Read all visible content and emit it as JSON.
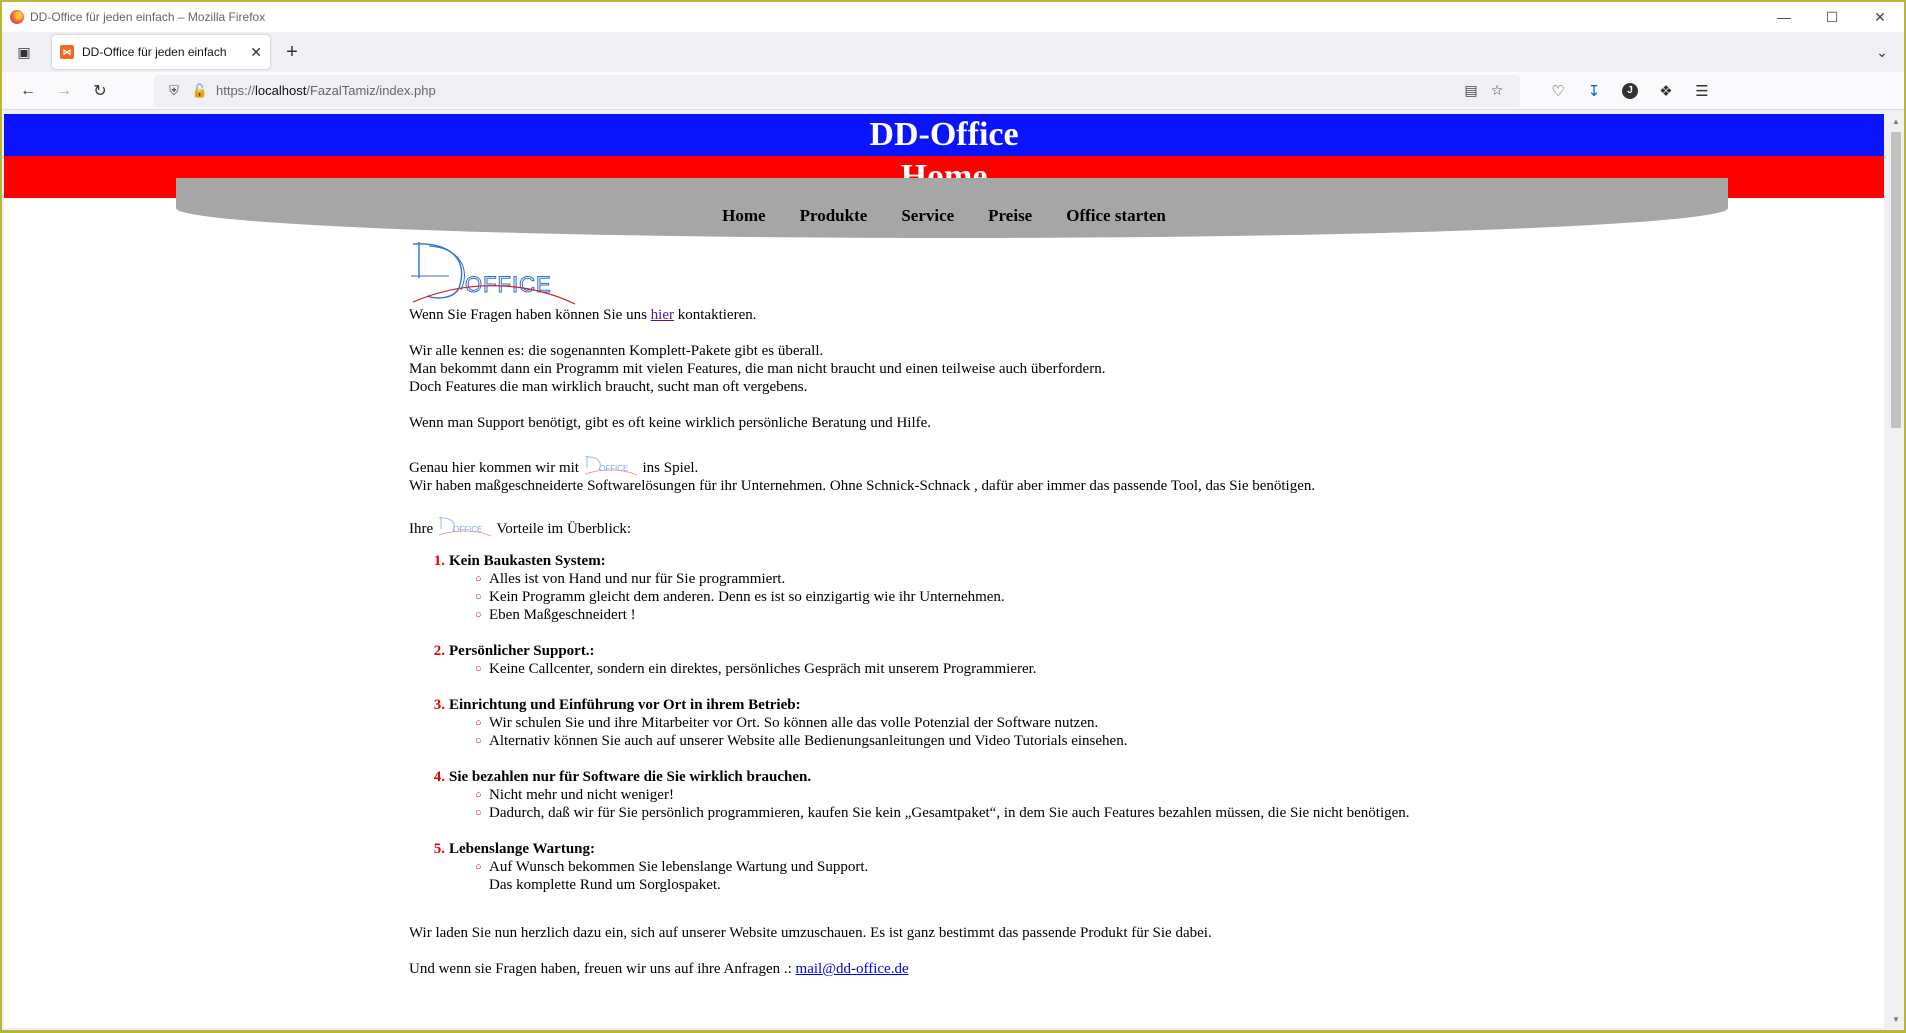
{
  "window": {
    "title": "DD-Office für jeden einfach – Mozilla Firefox"
  },
  "tab": {
    "title": "DD-Office für jeden einfach",
    "favicon": "xampp-icon"
  },
  "urlbar": {
    "prefix": "https://",
    "host": "localhost",
    "path": "/FazalTamiz/index.php"
  },
  "site": {
    "brand": "DD-Office",
    "page_title": "Home",
    "colors": {
      "header": "#0a14ff",
      "subheader": "#ff0000",
      "menu_bg": "#a6a6a6",
      "accent": "#e00000"
    },
    "menu": [
      "Home",
      "Produkte",
      "Service",
      "Preise",
      "Office starten"
    ],
    "logo_text": "OFFICE",
    "contact": {
      "before": "Wenn Sie Fragen haben können Sie uns ",
      "link": "hier",
      "after": " kontaktieren."
    },
    "intro": [
      "Wir alle kennen es: die sogenannten Komplett-Pakete gibt es überall.",
      "Man bekommt dann ein Programm mit vielen Features, die man nicht braucht und einen teilweise auch überfordern.",
      "Doch Features die man wirklich braucht, sucht man oft vergebens."
    ],
    "support": "Wenn man Support benötigt, gibt es oft keine wirklich persönliche Beratung und Hilfe.",
    "genau_before": "Genau hier kommen wir mit",
    "genau_after": "ins Spiel.",
    "tailored": "Wir haben maßgeschneiderte Softwarelösungen für ihr Unternehmen. Ohne Schnick-Schnack , dafür aber immer das passende Tool, das Sie benötigen.",
    "ihre_before": "Ihre",
    "ihre_after": "Vorteile im Überblick:",
    "advantages": [
      {
        "num": "1.",
        "title": "Kein Baukasten System:",
        "items": [
          "Alles ist von Hand und nur für Sie programmiert.",
          "Kein Programm gleicht dem anderen. Denn es ist so einzigartig wie ihr Unternehmen.",
          "Eben Maßgeschneidert !"
        ]
      },
      {
        "num": "2.",
        "title": "Persönlicher Support.:",
        "items": [
          "Keine Callcenter, sondern ein direktes, persönliches Gespräch mit unserem Programmierer."
        ]
      },
      {
        "num": "3.",
        "title": "Einrichtung und Einführung vor Ort in ihrem Betrieb:",
        "items": [
          "Wir schulen Sie und ihre Mitarbeiter vor Ort. So können alle das volle Potenzial der Software nutzen.",
          "Alternativ können Sie auch auf unserer Website alle Bedienungsanleitungen und Video Tutorials einsehen."
        ]
      },
      {
        "num": "4.",
        "title": "Sie bezahlen nur für Software die Sie wirklich brauchen.",
        "items": [
          "Nicht mehr und nicht weniger!",
          "Dadurch, daß wir für Sie persönlich programmieren, kaufen Sie kein „Gesamtpaket“, in dem Sie auch Features bezahlen müssen, die Sie nicht benötigen."
        ]
      },
      {
        "num": "5.",
        "title": "Lebenslange Wartung:",
        "items": [
          "Auf Wunsch bekommen Sie lebenslange Wartung und Support."
        ],
        "extra": "Das komplette Rund um Sorglospaket."
      }
    ],
    "invite": "Wir laden Sie nun herzlich dazu ein, sich auf unserer Website umzuschauen. Es ist ganz bestimmt das passende Produkt für Sie dabei.",
    "mail_before": "Und wenn sie Fragen haben, freuen wir uns auf ihre Anfragen .: ",
    "mail": "mail@dd-office.de"
  }
}
